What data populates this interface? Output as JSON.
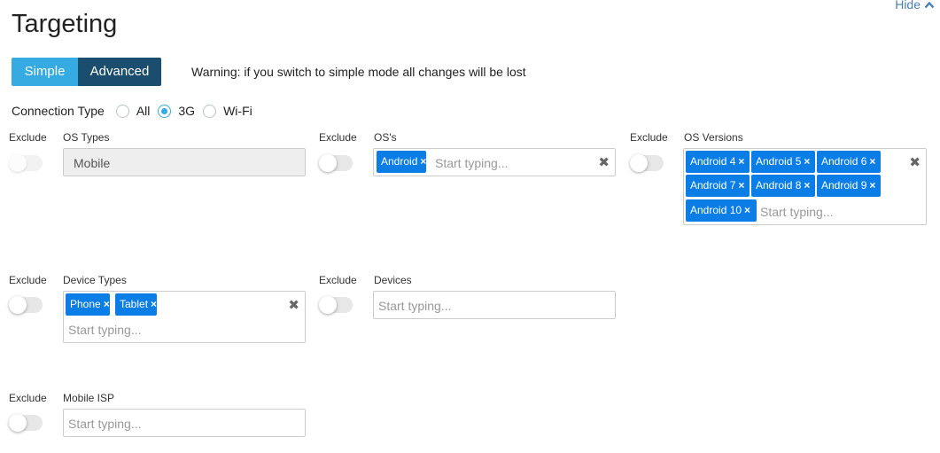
{
  "page": {
    "title": "Targeting",
    "hide_label": "Hide"
  },
  "mode": {
    "simple_label": "Simple",
    "advanced_label": "Advanced",
    "active": "Advanced",
    "warning": "Warning: if you switch to simple mode all changes will be lost"
  },
  "connection": {
    "label": "Connection Type",
    "options": [
      {
        "label": "All",
        "checked": false
      },
      {
        "label": "3G",
        "checked": true
      },
      {
        "label": "Wi-Fi",
        "checked": false
      }
    ]
  },
  "exclude_label": "Exclude",
  "placeholder": "Start typing...",
  "remove_glyph": "×",
  "clear_glyph": "✖",
  "fields": {
    "os_types": {
      "label": "OS Types",
      "value": "Mobile",
      "exclude": false
    },
    "oss": {
      "label": "OS's",
      "tags": [
        "Android"
      ],
      "exclude": false
    },
    "os_versions": {
      "label": "OS Versions",
      "tags": [
        "Android 4",
        "Android 5",
        "Android 6",
        "Android 7",
        "Android 8",
        "Android 9",
        "Android 10"
      ],
      "exclude": false
    },
    "device_types": {
      "label": "Device Types",
      "tags": [
        "Phone",
        "Tablet"
      ],
      "exclude": false
    },
    "devices": {
      "label": "Devices",
      "exclude": false
    },
    "mobile_isp": {
      "label": "Mobile ISP",
      "exclude": false
    }
  },
  "colors": {
    "accent": "#35abe2",
    "active_mode": "#1b4e6e",
    "chip": "#0b7de6",
    "link": "#4a7fb5"
  }
}
